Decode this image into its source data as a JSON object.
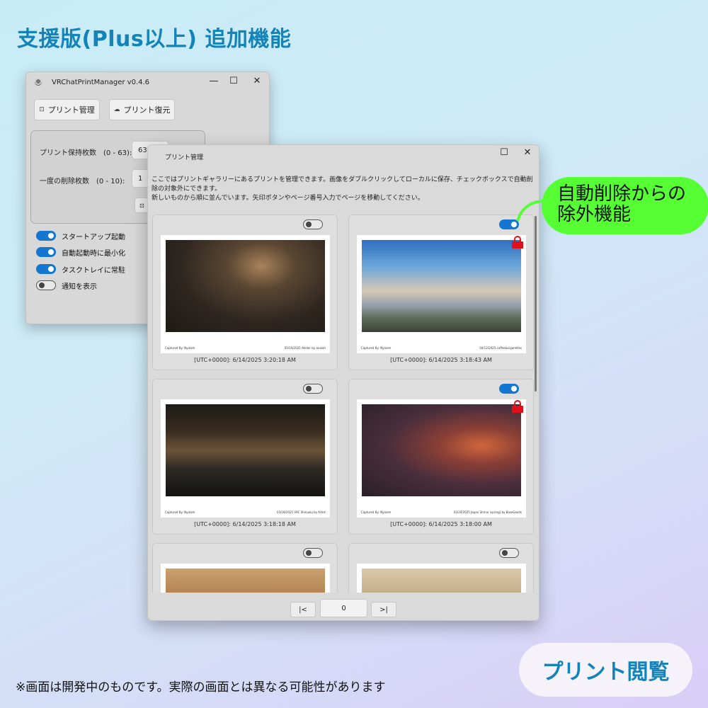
{
  "headline": "支援版(Plus以上) 追加機能",
  "disclaimer": "※画面は開発中のものです。実際の画面とは異なる可能性があります",
  "feature_pill": "プリント閲覧",
  "callout": {
    "line1": "自動削除からの",
    "line2": "除外機能"
  },
  "main_window": {
    "title": "VRChatPrintManager v0.4.6",
    "controls": {
      "minimize": "—",
      "maximize": "☐",
      "close": "✕"
    },
    "buttons": {
      "print_manage": "プリント管理",
      "print_restore": "プリント復元"
    },
    "settings": {
      "keep_label": "プリント保持枚数　(0 - 63):",
      "keep_value": "63",
      "delete_label": "一度の削除枚数　(0 - 10):",
      "delete_value": "1"
    },
    "toggles": [
      {
        "label": "スタートアップ起動",
        "on": true
      },
      {
        "label": "自動起動時に最小化",
        "on": true
      },
      {
        "label": "タスクトレイに常駐",
        "on": true
      },
      {
        "label": "通知を表示",
        "on": false
      }
    ]
  },
  "print_window": {
    "title": "プリント管理",
    "controls": {
      "maximize": "☐",
      "close": "✕"
    },
    "description_line1": "ここではプリントギャラリーにあるプリントを管理できます。画像をダブルクリックしてローカルに保存、チェックボックスで自動削除の対象外にできます。",
    "description_line2": "新しいものから順に並んでいます。矢印ボタンやページ番号入力でページを移動してください。",
    "cards": [
      {
        "timestamp": "[UTC+0000]: 6/14/2025 3:20:18 AM",
        "excluded": false,
        "caption_left": "Captured By: Nyalam",
        "caption_right": "05/10/2025 Atelier by anaiah"
      },
      {
        "timestamp": "[UTC+0000]: 6/14/2025 3:18:43 AM",
        "excluded": true,
        "caption_left": "Captured By: Nyalam",
        "caption_right": "04/12/2025 coffee&cigarettes"
      },
      {
        "timestamp": "[UTC+0000]: 6/14/2025 3:18:18 AM",
        "excluded": false,
        "caption_left": "Captured By: Nyalam",
        "caption_right": "03/18/2025 VRC Shinjuku by Artist"
      },
      {
        "timestamp": "[UTC+0000]: 6/14/2025 3:18:00 AM",
        "excluded": true,
        "caption_left": "Captured By: Nyalam",
        "caption_right": "03/20/2025 Japan Shrine (spring) by BaseGoods"
      },
      {
        "timestamp": "",
        "excluded": false,
        "caption_left": "",
        "caption_right": ""
      },
      {
        "timestamp": "",
        "excluded": false,
        "caption_left": "",
        "caption_right": ""
      }
    ],
    "pager": {
      "prev": "|<",
      "page": "0",
      "next": ">|"
    }
  }
}
